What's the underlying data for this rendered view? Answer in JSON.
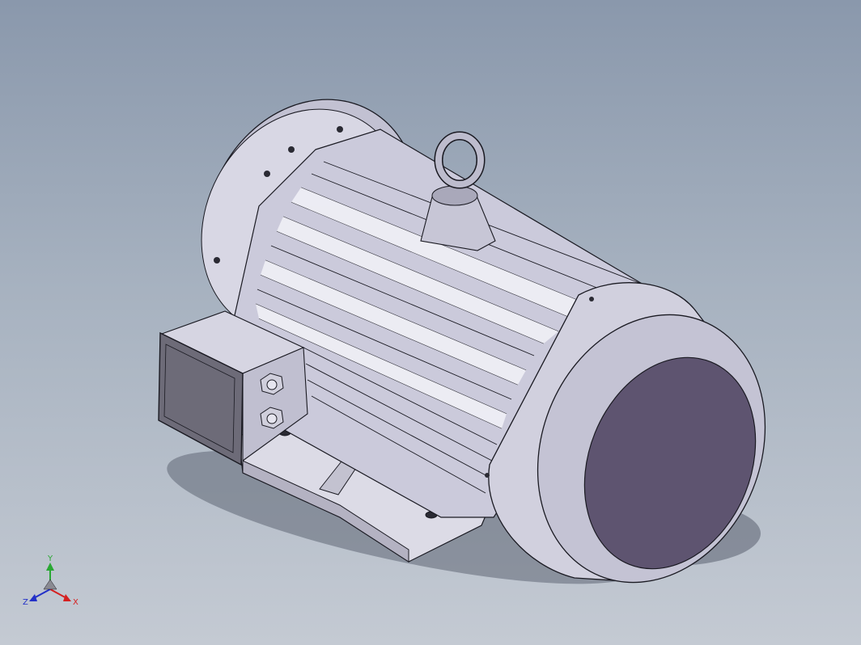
{
  "viewport": {
    "background_top": "#8a98ac",
    "background_bottom": "#c4cad3"
  },
  "model": {
    "type": "electric-motor",
    "body_color": "#c9c8d8",
    "shadow_color": "#5f6674",
    "fan_cover_face_color": "#5e5470",
    "terminal_box_face_color": "#6d6b78",
    "edge_color": "#1a1a22"
  },
  "triad": {
    "x_label": "X",
    "y_label": "Y",
    "z_label": "Z",
    "x_color": "#d52020",
    "y_color": "#2aa834",
    "z_color": "#2230c8"
  }
}
